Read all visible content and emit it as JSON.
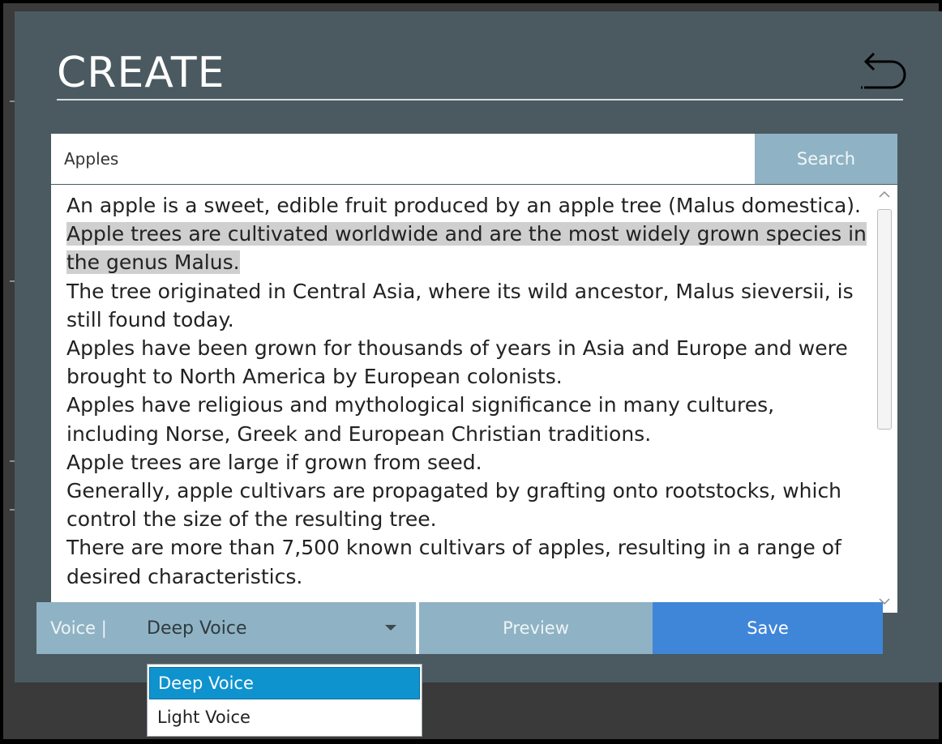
{
  "header": {
    "title": "CREATE",
    "back_icon": "undo-arrow-icon"
  },
  "search": {
    "value": "Apples",
    "button_label": "Search"
  },
  "article": {
    "lines": [
      "An apple is a sweet, edible fruit produced by an apple tree (Malus domestica).",
      "Apple trees are cultivated worldwide and are the most widely grown species in the genus Malus.",
      "The tree originated in Central Asia, where its wild ancestor, Malus sieversii, is still found today.",
      "Apples have been grown for thousands of years in Asia and Europe and were brought to North America by European colonists.",
      "Apples have religious and mythological significance in many cultures, including Norse, Greek and European Christian traditions.",
      "Apple trees are large if grown from seed.",
      "Generally, apple cultivars are propagated by grafting onto rootstocks, which control the size of the resulting tree.",
      "There are more than 7,500 known cultivars of apples, resulting in a range of desired characteristics."
    ],
    "highlighted_line": 1
  },
  "voice": {
    "label": "Voice |",
    "selected": "Deep Voice",
    "options": [
      "Deep Voice",
      "Light Voice"
    ]
  },
  "actions": {
    "preview_label": "Preview",
    "save_label": "Save"
  },
  "colors": {
    "dialog_bg": "#4a5a60",
    "accent_light": "#8fb3c4",
    "save_blue": "#3f86d8",
    "dropdown_selected": "#0f93cf"
  }
}
